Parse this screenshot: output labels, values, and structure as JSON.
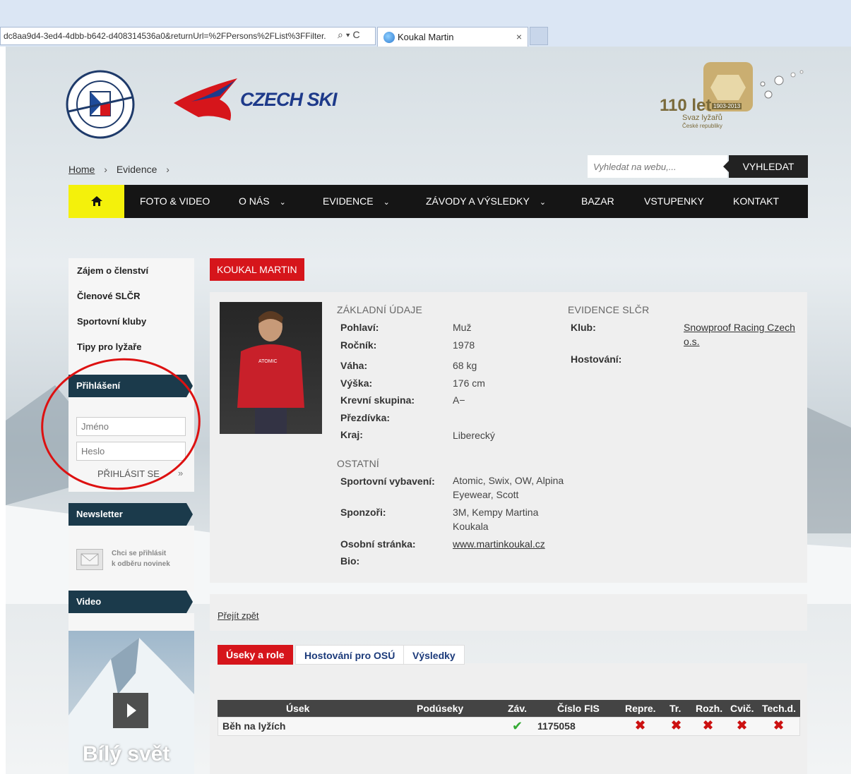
{
  "browser": {
    "address": "dc8aa9d4-3ed4-4dbb-b642-d408314536a0&returnUrl=%2FPersons%2FList%3FFilter.",
    "address_icons": "⌕ ▾ C",
    "tab_title": "Koukal Martin",
    "tab_close": "×"
  },
  "header": {
    "brand": "CZECH SKI",
    "anniversary": "110 let",
    "anniversary_sub1": "Svaz lyžařů",
    "anniversary_sub2": "České republiky",
    "anniversary_years": "1903-2013"
  },
  "breadcrumb": {
    "items": [
      "Home",
      "Evidence"
    ],
    "sep": "›"
  },
  "search": {
    "placeholder": "Vyhledat na webu,...",
    "button": "VYHLEDAT"
  },
  "nav": {
    "items": [
      "FOTO & VIDEO",
      "O NÁS",
      "EVIDENCE",
      "ZÁVODY A VÝSLEDKY",
      "BAZAR",
      "VSTUPENKY",
      "KONTAKT"
    ],
    "chevron": "⌄"
  },
  "sidebar": {
    "links": [
      "Zájem o členství",
      "Členové SLČR",
      "Sportovní kluby",
      "Tipy pro lyžaře"
    ],
    "login_head": "Přihlášení",
    "login_name_placeholder": "Jméno",
    "login_pass_placeholder": "Heslo",
    "login_button": "PŘIHLÁSIT SE",
    "login_arrow": "»",
    "newsletter_head": "Newsletter",
    "newsletter_text1": "Chci se přihlásit",
    "newsletter_text2": "k odběru novinek",
    "video_head": "Video",
    "video_title": "Bílý svět"
  },
  "person": {
    "title": "KOUKAL MARTIN",
    "basic_head": "ZÁKLADNÍ ÚDAJE",
    "evidence_head": "EVIDENCE SLČR",
    "other_head": "OSTATNÍ",
    "fields": {
      "gender_label": "Pohlaví:",
      "gender": "Muž",
      "year_label": "Ročník:",
      "year": "1978",
      "weight_label": "Váha:",
      "weight": "68 kg",
      "height_label": "Výška:",
      "height": "176 cm",
      "blood_label": "Krevní skupina:",
      "blood": "A−",
      "nick_label": "Přezdívka:",
      "region_label": "Kraj:",
      "region": "Liberecký",
      "club_label": "Klub:",
      "club_line1": "Snowproof Racing Czech",
      "club_line2": "o.s.",
      "guest_label": "Hostování:",
      "equipment_label": "Sportovní vybavení:",
      "equipment_line1": "Atomic, Swix, OW, Alpina",
      "equipment_line2": "Eyewear, Scott",
      "sponsors_label": "Sponzoři:",
      "sponsors_line1": "3M, Kempy Martina",
      "sponsors_line2": "Koukala",
      "web_label": "Osobní stránka:",
      "web": "www.martinkoukal.cz",
      "bio_label": "Bio:"
    },
    "back": "Přejít zpět"
  },
  "tabs": {
    "items": [
      "Úseky a role",
      "Hostování pro OSÚ",
      "Výsledky"
    ]
  },
  "grid": {
    "headers": [
      "Úsek",
      "Podúseky",
      "Záv.",
      "Číslo FIS",
      "Repre.",
      "Tr.",
      "Rozh.",
      "Cvič.",
      "Tech.d."
    ],
    "row": {
      "usek": "Běh na lyžích",
      "podus": "",
      "zav": "✔",
      "fis": "1175058",
      "marks": [
        "✖",
        "✖",
        "✖",
        "✖",
        "✖"
      ]
    }
  }
}
